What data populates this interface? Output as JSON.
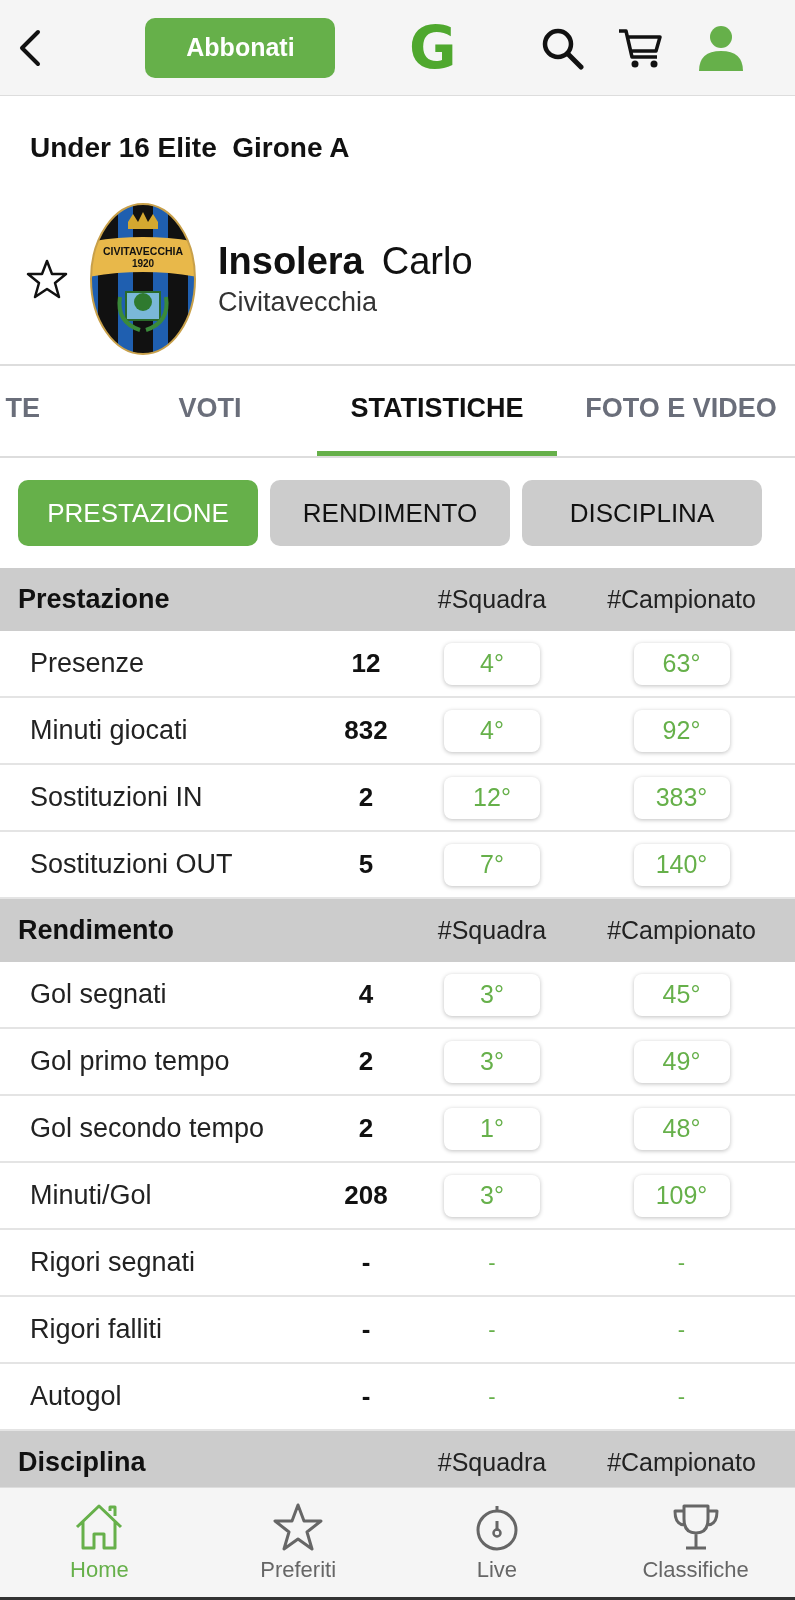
{
  "top_bar": {
    "subscribe_button": "Abbonati",
    "logo_letter": "G"
  },
  "competition": "Under 16 Elite  Girone A",
  "player": {
    "favorite": false,
    "surname": "Insolera",
    "name": "Carlo",
    "team": "Civitavecchia",
    "crest_texts": [
      "CIVITAVECCHIA",
      "1920"
    ]
  },
  "tabs": [
    {
      "label": "TE",
      "selected": false
    },
    {
      "label": "VOTI",
      "selected": false
    },
    {
      "label": "STATISTICHE",
      "selected": true
    },
    {
      "label": "FOTO E VIDEO",
      "selected": false
    }
  ],
  "filters": [
    {
      "label": "PRESTAZIONE",
      "selected": true
    },
    {
      "label": "RENDIMENTO",
      "selected": false
    },
    {
      "label": "DISCIPLINA",
      "selected": false
    }
  ],
  "sections": [
    {
      "title": "Prestazione",
      "col_team": "#Squadra",
      "col_league": "#Campionato",
      "rows": [
        {
          "label": "Presenze",
          "value": "12",
          "team_rank": "4°",
          "league_rank": "63°",
          "boxed": true
        },
        {
          "label": "Minuti giocati",
          "value": "832",
          "team_rank": "4°",
          "league_rank": "92°",
          "boxed": true
        },
        {
          "label": "Sostituzioni IN",
          "value": "2",
          "team_rank": "12°",
          "league_rank": "383°",
          "boxed": true
        },
        {
          "label": "Sostituzioni OUT",
          "value": "5",
          "team_rank": "7°",
          "league_rank": "140°",
          "boxed": true
        }
      ]
    },
    {
      "title": "Rendimento",
      "col_team": "#Squadra",
      "col_league": "#Campionato",
      "rows": [
        {
          "label": "Gol segnati",
          "value": "4",
          "team_rank": "3°",
          "league_rank": "45°",
          "boxed": true
        },
        {
          "label": "Gol primo tempo",
          "value": "2",
          "team_rank": "3°",
          "league_rank": "49°",
          "boxed": true
        },
        {
          "label": "Gol secondo tempo",
          "value": "2",
          "team_rank": "1°",
          "league_rank": "48°",
          "boxed": true
        },
        {
          "label": "Minuti/Gol",
          "value": "208",
          "team_rank": "3°",
          "league_rank": "109°",
          "boxed": true
        },
        {
          "label": "Rigori segnati",
          "value": "-",
          "team_rank": "-",
          "league_rank": "-",
          "boxed": false
        },
        {
          "label": "Rigori falliti",
          "value": "-",
          "team_rank": "-",
          "league_rank": "-",
          "boxed": false
        },
        {
          "label": "Autogol",
          "value": "-",
          "team_rank": "-",
          "league_rank": "-",
          "boxed": false
        }
      ]
    },
    {
      "title": "Disciplina",
      "col_team": "#Squadra",
      "col_league": "#Campionato"
    }
  ],
  "bottom_nav": [
    {
      "label": "Home",
      "selected": true
    },
    {
      "label": "Preferiti",
      "selected": false
    },
    {
      "label": "Live",
      "selected": false
    },
    {
      "label": "Classifiche",
      "selected": false
    }
  ]
}
